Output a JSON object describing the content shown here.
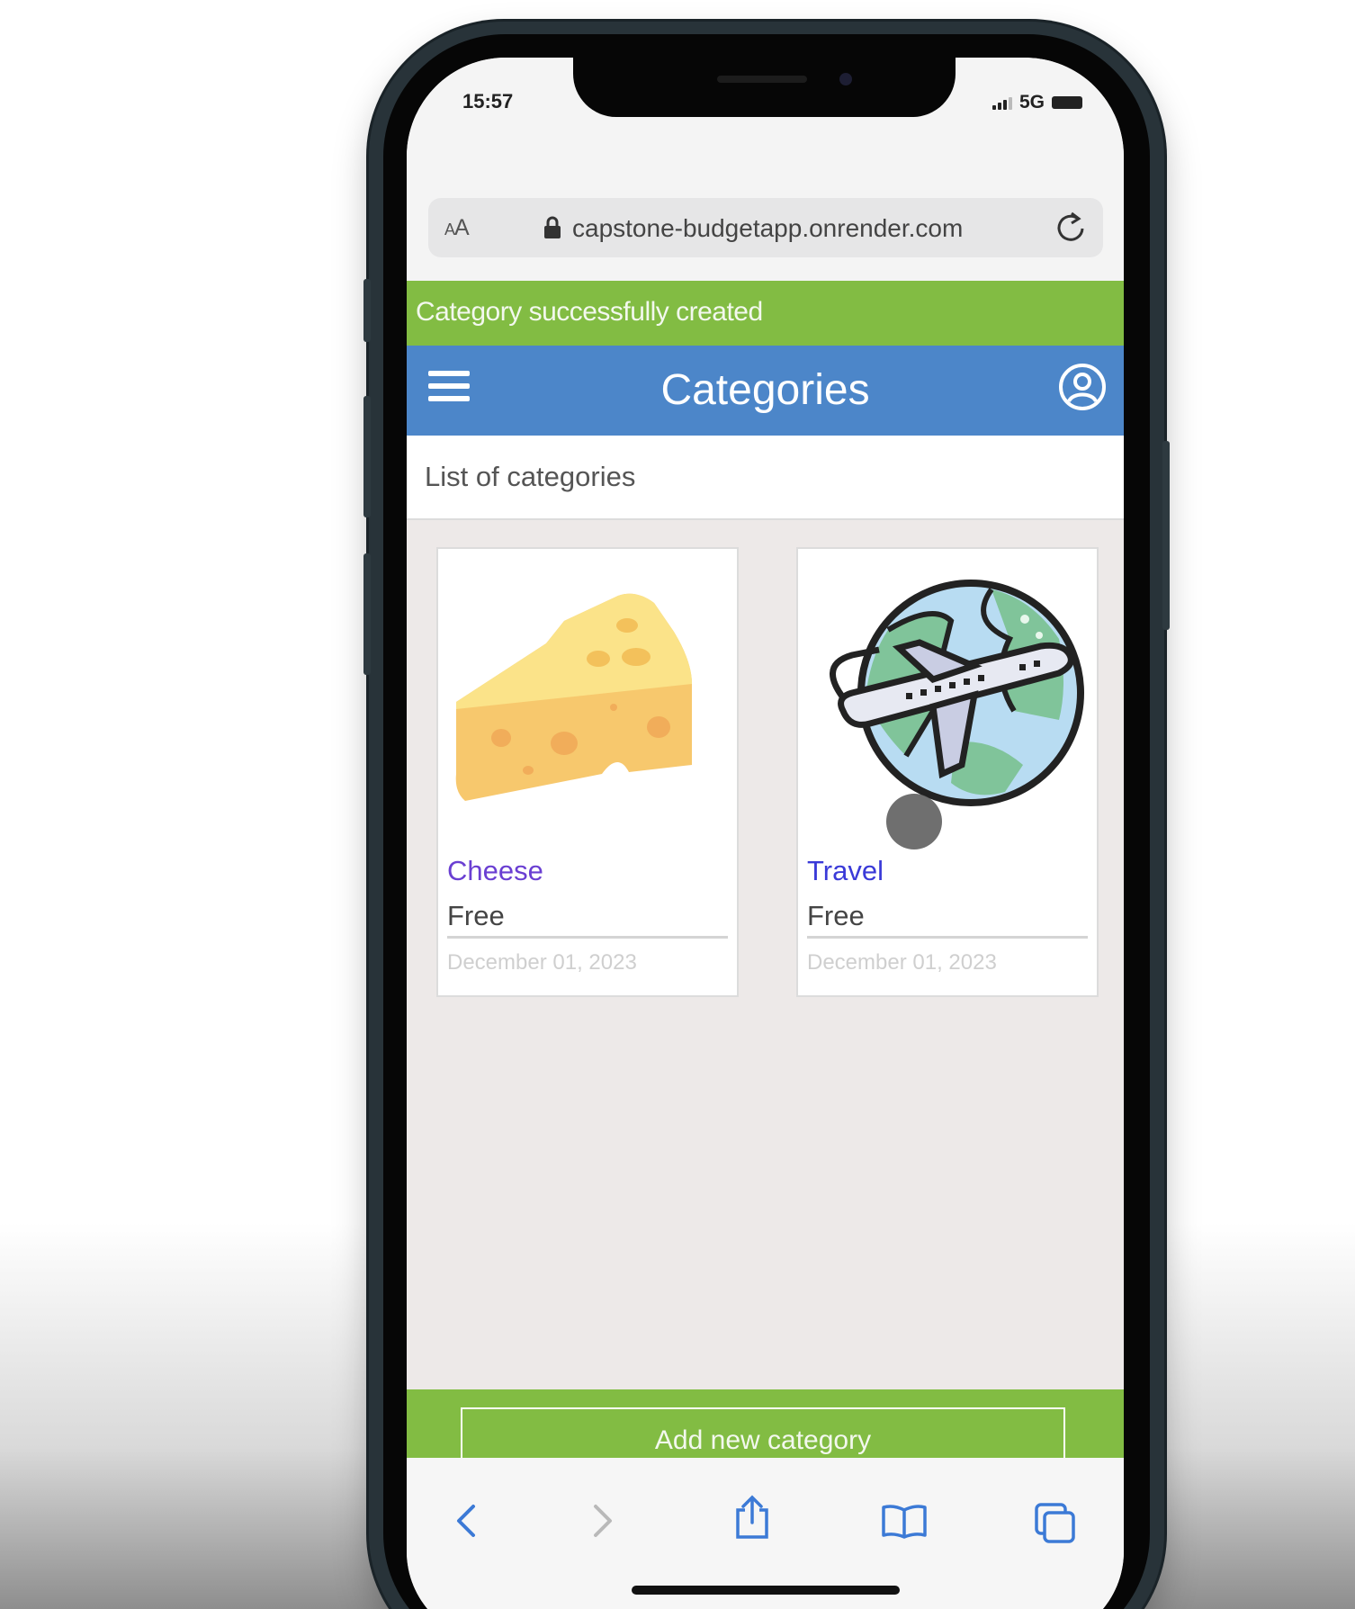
{
  "status_bar": {
    "time": "15:57",
    "network": "5G"
  },
  "browser": {
    "text_size_button": {
      "big": "A",
      "small": "A"
    },
    "url": "capstone-budgetapp.onrender.com"
  },
  "notice": {
    "message": "Category successfully created",
    "color": "#82bc43"
  },
  "header": {
    "title": "Categories",
    "color": "#4c86c9"
  },
  "subheader": {
    "text": "List of categories"
  },
  "categories": [
    {
      "name": "Cheese",
      "type": "Free",
      "date": "December 01, 2023",
      "icon": "cheese-icon"
    },
    {
      "name": "Travel",
      "type": "Free",
      "date": "December 01, 2023",
      "icon": "globe-airplane-icon"
    }
  ],
  "footer": {
    "add_button_label": "Add new category"
  },
  "toolbar": {
    "icons": [
      "back-icon",
      "forward-icon",
      "share-icon",
      "bookmarks-icon",
      "tabs-icon"
    ]
  }
}
